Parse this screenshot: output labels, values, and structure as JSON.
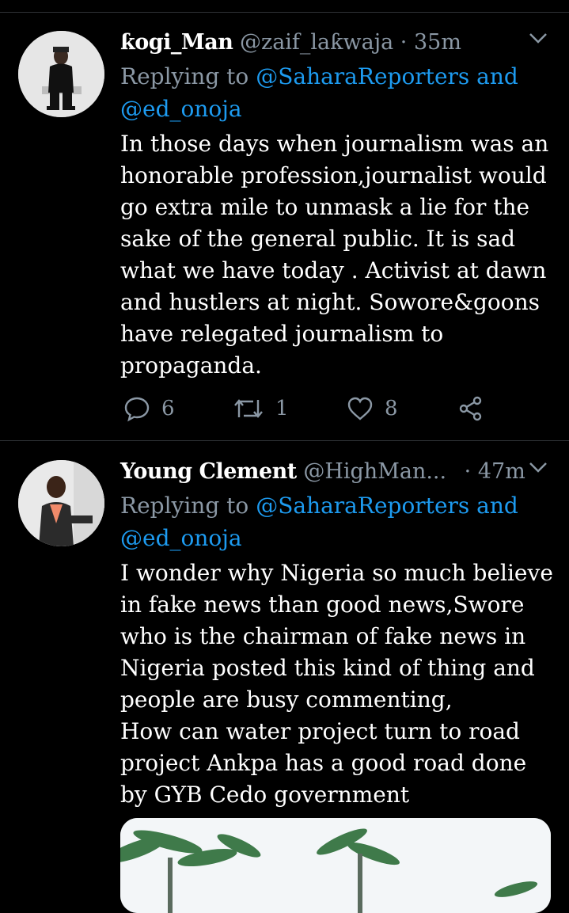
{
  "tweets": [
    {
      "name": "ƙogi_Man",
      "handle": "@zaif_laƙwaja",
      "separator": "·",
      "time": "35m",
      "replying_prefix": "Replying to",
      "reply_to_1": "@SaharaReporters and",
      "reply_to_2": "@ed_onoja",
      "text": "In those days when journalism was an honorable profession,journalist would go extra mile to unmask a lie for the sake of the general public. It is sad what we have today . Activist at dawn and hustlers at night. Sowore&goons have relegated journalism to propaganda.",
      "replies": "6",
      "retweets": "1",
      "likes": "8"
    },
    {
      "name": "Young Clement",
      "handle": "@HighMan...",
      "separator": "·",
      "time": "47m",
      "replying_prefix": "Replying to",
      "reply_to_1": "@SaharaReporters and",
      "reply_to_2": "@ed_onoja",
      "text": "I wonder why Nigeria so much believe in fake news than good news,Swore who is the chairman of fake news in Nigeria posted this kind of thing and people are busy commenting,\nHow can water project turn to road project Ankpa has a good  road done by GYB Cedo government"
    }
  ],
  "colors": {
    "background": "#000000",
    "secondary_text": "#8b98a5",
    "link": "#1d9bf0",
    "divider": "#2f3336"
  },
  "icons": {
    "reply": "speech-bubble-icon",
    "retweet": "retweet-arrows-icon",
    "like": "heart-outline-icon",
    "share": "share-nodes-icon",
    "menu": "chevron-down-icon"
  }
}
